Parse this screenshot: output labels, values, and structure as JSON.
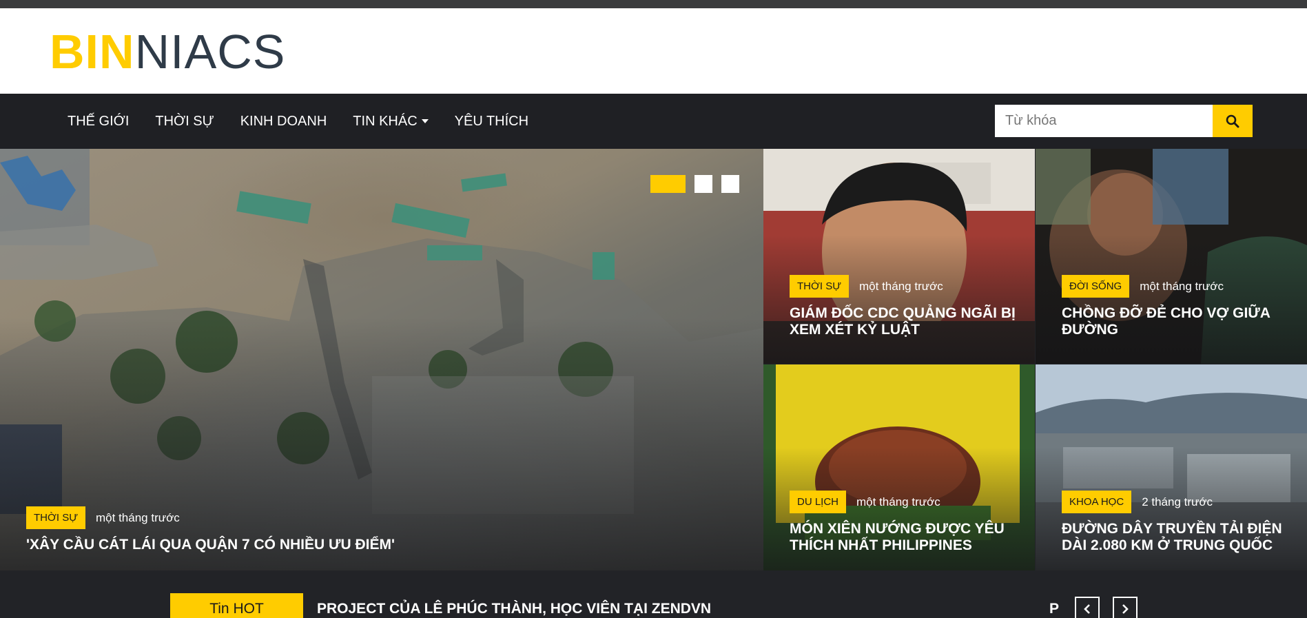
{
  "brand": {
    "part1": "BIN",
    "part2": "NIACS"
  },
  "nav": {
    "items": [
      "THẾ GIỚI",
      "THỜI SỰ",
      "KINH DOANH",
      "TIN KHÁC",
      "YÊU THÍCH"
    ],
    "search_placeholder": "Từ khóa"
  },
  "hero": {
    "category": "THỜI SỰ",
    "time": "một tháng trước",
    "title": "'XÂY CẦU CÁT LÁI QUA QUẬN 7 CÓ NHIỀU ƯU ĐIỂM'",
    "slides": {
      "count": 3,
      "active": 1
    }
  },
  "cards": [
    {
      "category": "THỜI SỰ",
      "time": "một tháng trước",
      "title": "GIÁM ĐỐC CDC QUẢNG NGÃI BỊ XEM XÉT KỶ LUẬT"
    },
    {
      "category": "ĐỜI SỐNG",
      "time": "một tháng trước",
      "title": "CHỒNG ĐỠ ĐẺ CHO VỢ GIỮA ĐƯỜNG"
    },
    {
      "category": "DU LỊCH",
      "time": "một tháng trước",
      "title": "MÓN XIÊN NƯỚNG ĐƯỢC YÊU THÍCH NHẤT PHILIPPINES"
    },
    {
      "category": "KHOA HỌC",
      "time": "2 tháng trước",
      "title": "ĐƯỜNG DÂY TRUYỀN TẢI ĐIỆN DÀI 2.080 KM Ở TRUNG QUỐC"
    }
  ],
  "ticker": {
    "label": "Tin HOT",
    "title": "PROJECT CỦA LÊ PHÚC THÀNH, HỌC VIÊN TẠI ZENDVN",
    "next_fragment": "PI"
  },
  "icons": {
    "search": "search-icon",
    "prev": "chevron-left-icon",
    "next": "chevron-right-icon",
    "dropdown": "caret-down-icon"
  },
  "colors": {
    "accent": "#ffcc00",
    "nav_bg": "#1f2024",
    "logo_dark": "#2f3b48",
    "top_strip": "#3a3b3d"
  }
}
